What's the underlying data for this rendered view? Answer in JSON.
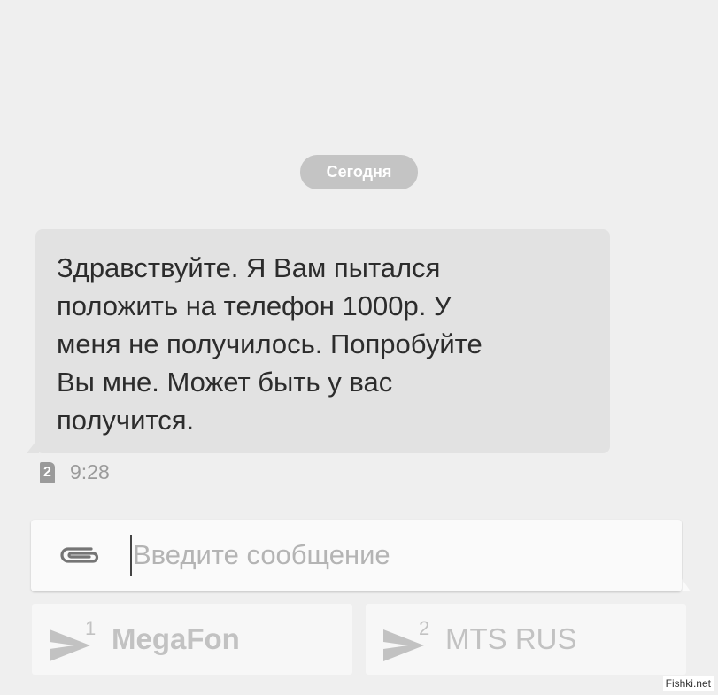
{
  "date_separator": "Сегодня",
  "message": {
    "lines": [
      "Здравствуйте. Я Вам пытался",
      "положить на телефон 1000р. У",
      "меня не получилось. Попробуйте",
      "Вы мне. Может быть у вас",
      "получится."
    ],
    "sim_slot": "2",
    "time": "9:28"
  },
  "compose": {
    "placeholder": "Введите сообщение",
    "attach_icon": "paperclip-icon"
  },
  "send_buttons": [
    {
      "sim": "1",
      "carrier": "MegaFon",
      "icon": "send-icon"
    },
    {
      "sim": "2",
      "carrier": "MTS RUS",
      "icon": "send-icon"
    }
  ],
  "watermark": "Fishki.net"
}
